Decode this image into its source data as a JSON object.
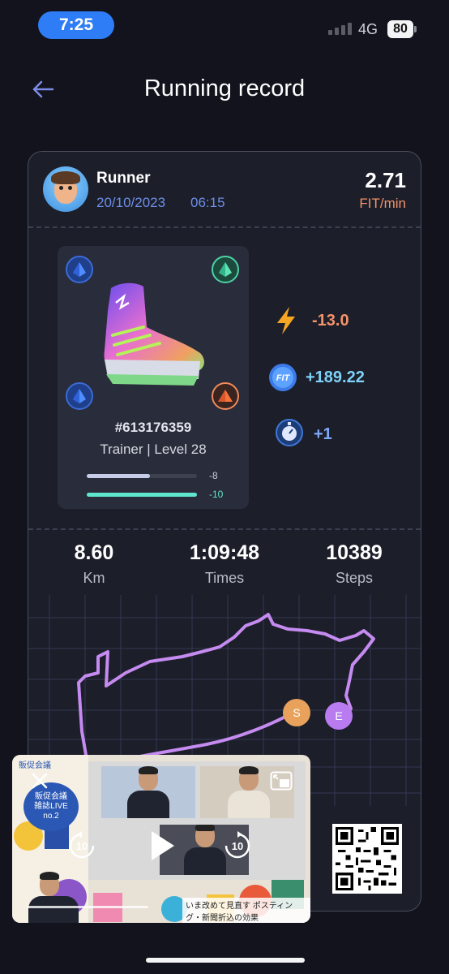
{
  "status_bar": {
    "time": "7:25",
    "network": "4G",
    "battery": "80"
  },
  "header": {
    "title": "Running record",
    "back_icon": "arrow-left-icon"
  },
  "runner": {
    "name": "Runner",
    "date": "20/10/2023",
    "time": "06:15",
    "rate_value": "2.71",
    "rate_unit": "FIT/min"
  },
  "sneaker": {
    "id": "#613176359",
    "meta": "Trainer | Level 28",
    "bar1": {
      "label": "-8",
      "fill": 0.57,
      "color": "#c7cde8"
    },
    "bar2": {
      "label": "-10",
      "fill": 1.0,
      "color": "#5ee6cf"
    }
  },
  "rewards": [
    {
      "icon": "lightning-icon",
      "value": "-13.0",
      "color": "#f3936a"
    },
    {
      "icon": "fit-token-icon",
      "value": "+189.22",
      "color": "#7ed2f7"
    },
    {
      "icon": "stopwatch-badge-icon",
      "value": "+1",
      "color": "#7fa8f7"
    }
  ],
  "stats": [
    {
      "value": "8.60",
      "label": "Km"
    },
    {
      "value": "1:09:48",
      "label": "Times"
    },
    {
      "value": "10389",
      "label": "Steps"
    }
  ],
  "map": {
    "start_label": "S",
    "end_label": "E",
    "route_color": "#c58bf0"
  },
  "video": {
    "brand": "販促会議",
    "badge_line1": "販促会議",
    "badge_line2": "雑誌LIVE",
    "badge_line3": "no.2",
    "caption": "いま改めて見直す ポスティング・新聞折込の効果",
    "rewind_label": "10",
    "forward_label": "10"
  }
}
